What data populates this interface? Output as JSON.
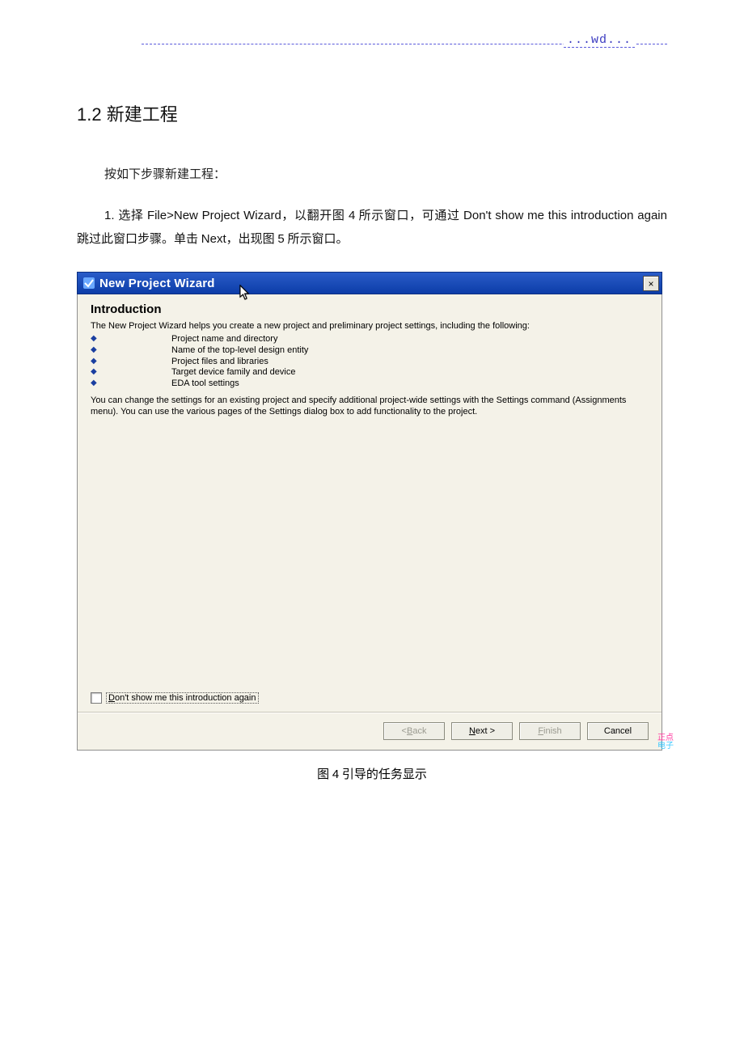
{
  "header": {
    "wd": "...wd..."
  },
  "section": {
    "number": "1.2",
    "title": "新建工程"
  },
  "intro_line": "按如下步骤新建工程：",
  "step1": {
    "num": "1.",
    "t1": "选择 ",
    "menu": "File>New Project Wizard",
    "t2": "，以翻开图 ",
    "fig_a": "4",
    "t3": " 所示窗口，可通过 ",
    "skip": "Don't show me this introduction again",
    "t4": " 跳过此窗口步骤。单击 ",
    "next": "Next",
    "t5": "，出现图 ",
    "fig_b": "5",
    "t6": " 所示窗口。"
  },
  "dialog": {
    "title": "New Project Wizard",
    "heading": "Introduction",
    "intro": "The New Project Wizard helps you create a new project and preliminary project settings, including the following:",
    "bullets": [
      "Project name and directory",
      "Name of the top-level design entity",
      "Project files and libraries",
      "Target device family and device",
      "EDA tool settings"
    ],
    "note": "You can change the settings for an existing project and specify additional project-wide settings with the Settings command (Assignments menu). You can use the various pages of the Settings dialog box to add functionality to the project.",
    "dont_show_D": "D",
    "dont_show_rest": "on't show me this introduction again",
    "btn_back_lt": "< ",
    "btn_back_u": "B",
    "btn_back_rest": "ack",
    "btn_next_u": "N",
    "btn_next_rest": "ext >",
    "btn_finish_u": "F",
    "btn_finish_rest": "inish",
    "btn_cancel": "Cancel",
    "close_x": "×"
  },
  "watermark": {
    "a": "正点",
    "b": "电子"
  },
  "caption": {
    "pre": "图 ",
    "num": "4",
    "post": "  引导的任务显示"
  }
}
